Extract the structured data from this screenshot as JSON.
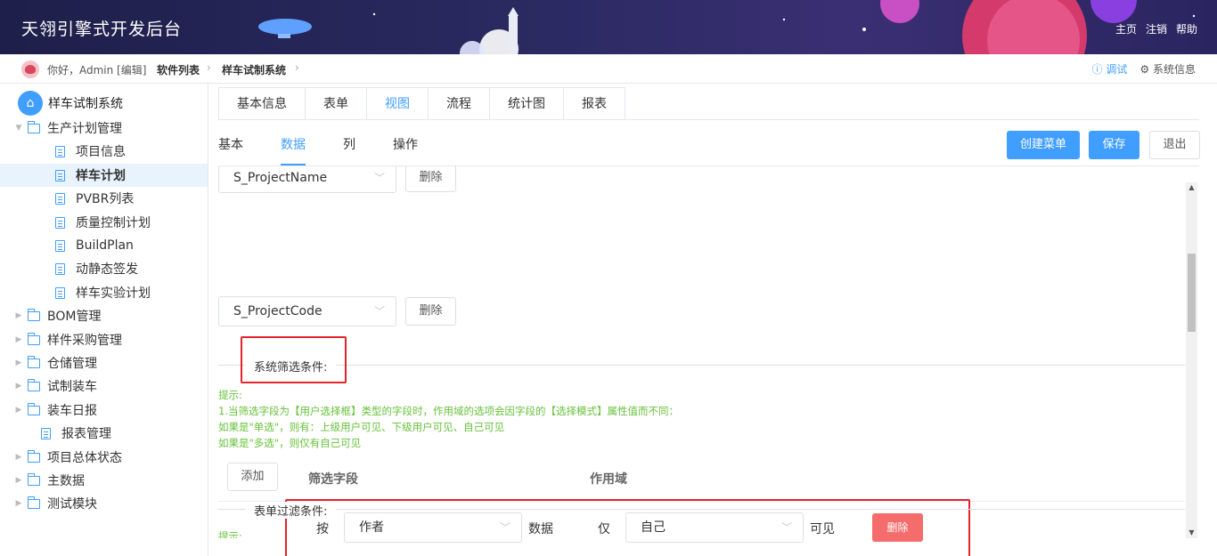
{
  "header": {
    "title": "天翎引擎式开发后台",
    "links": [
      "主页",
      "注销",
      "帮助"
    ]
  },
  "topbar": {
    "greeting": "你好，Admin [编辑]",
    "breadcrumbs": [
      "软件列表",
      "样车试制系统"
    ],
    "debug": "ⓘ 调试",
    "sysinfo": "⚙ 系统信息"
  },
  "sidebar": {
    "root": "样车试制系统",
    "items": [
      {
        "label": "生产计划管理",
        "type": "folder",
        "level": 1,
        "expanded": true
      },
      {
        "label": "项目信息",
        "type": "doc",
        "level": 2
      },
      {
        "label": "样车计划",
        "type": "doc",
        "level": 2,
        "active": true
      },
      {
        "label": "PVBR列表",
        "type": "doc",
        "level": 2
      },
      {
        "label": "质量控制计划",
        "type": "doc",
        "level": 2
      },
      {
        "label": "BuildPlan",
        "type": "doc",
        "level": 2
      },
      {
        "label": "动静态签发",
        "type": "doc",
        "level": 2
      },
      {
        "label": "样车实验计划",
        "type": "doc",
        "level": 2
      },
      {
        "label": "BOM管理",
        "type": "folder",
        "level": 1
      },
      {
        "label": "样件采购管理",
        "type": "folder",
        "level": 1
      },
      {
        "label": "仓储管理",
        "type": "folder",
        "level": 1
      },
      {
        "label": "试制装车",
        "type": "folder",
        "level": 1
      },
      {
        "label": "装车日报",
        "type": "folder",
        "level": 1
      },
      {
        "label": "报表管理",
        "type": "doc",
        "level": 1
      },
      {
        "label": "项目总体状态",
        "type": "folder",
        "level": 1
      },
      {
        "label": "主数据",
        "type": "folder",
        "level": 1
      },
      {
        "label": "测试模块",
        "type": "folder",
        "level": 1
      }
    ]
  },
  "tabs_main": [
    "基本信息",
    "表单",
    "视图",
    "流程",
    "统计图",
    "报表"
  ],
  "tabs_sub": [
    "基本",
    "数据",
    "列",
    "操作"
  ],
  "actions": {
    "create_menu": "创建菜单",
    "save": "保存",
    "exit": "退出"
  },
  "fields": [
    {
      "value": "S_ProjectName",
      "delete": "删除"
    },
    {
      "value": "S_ProjectCode",
      "delete": "删除"
    }
  ],
  "system_filter": {
    "title": "系统筛选条件:",
    "hint": [
      "提示:",
      "1.当筛选字段为【用户选择框】类型的字段时，作用域的选项会因字段的【选择模式】属性值而不同：",
      "如果是\"单选\"，则有：上级用户可见、下级用户可见、自己可见",
      "如果是\"多选\"，则仅有自己可见"
    ],
    "add": "添加",
    "col_field": "筛选字段",
    "col_scope": "作用域",
    "row": {
      "by": "按",
      "field": "作者",
      "data": "数据",
      "only": "仅",
      "scope": "自己",
      "visible": "可见",
      "delete": "删除"
    }
  },
  "form_filter": {
    "title": "表单过滤条件:",
    "hint_partial": "提示:"
  },
  "colors": {
    "accent": "#409eff",
    "danger": "#f56c6c",
    "hint": "#67c23a",
    "highlight": "#e5242a"
  }
}
